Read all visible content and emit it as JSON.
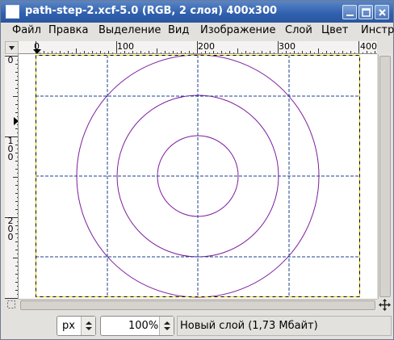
{
  "window": {
    "title": "path-step-2.xcf-5.0 (RGB, 2 слоя) 400x300",
    "buttons": [
      "minimize-icon",
      "maximize-icon",
      "close-icon"
    ]
  },
  "menubar": {
    "items": [
      "Файл",
      "Правка",
      "Выделение",
      "Вид",
      "Изображение",
      "Слой",
      "Цвет",
      "Инстр"
    ]
  },
  "rulers": {
    "horizontal_labels": [
      "0",
      "100",
      "200",
      "300",
      "400"
    ],
    "vertical_labels": [
      "0",
      "100",
      "200"
    ]
  },
  "canvas": {
    "image_size": "400x300",
    "guide_color": "#1f3f8f",
    "path_color": "#7d1e9e",
    "selection_color": "#e8d300"
  },
  "statusbar": {
    "unit": "px",
    "zoom": "100%",
    "message": "Новый слой (1,73 Мбайт)"
  }
}
